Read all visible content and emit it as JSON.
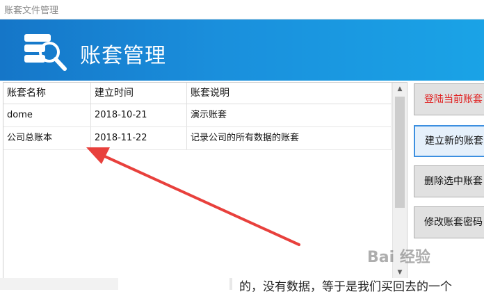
{
  "window": {
    "title": "账套文件管理"
  },
  "banner": {
    "heading": "账套管理",
    "logo_icon": "database-search-icon"
  },
  "table": {
    "columns": [
      "账套名称",
      "建立时间",
      "账套说明"
    ],
    "rows": [
      [
        "dome",
        "2018-10-21",
        "演示账套"
      ],
      [
        "公司总账本",
        "2018-11-22",
        "记录公司的所有数据的账套"
      ]
    ]
  },
  "buttons": {
    "login": "登陆当前账套",
    "create": "建立新的账套",
    "delete": "删除选中账套",
    "change_password": "修改账套密码"
  },
  "page": {
    "article_fragment": "的，没有数据，等于是我们买回去的一个",
    "watermark": "Bai 经验"
  },
  "colors": {
    "banner": "#1a8fdc",
    "login_text": "#e02020",
    "arrow": "#e8403c"
  }
}
